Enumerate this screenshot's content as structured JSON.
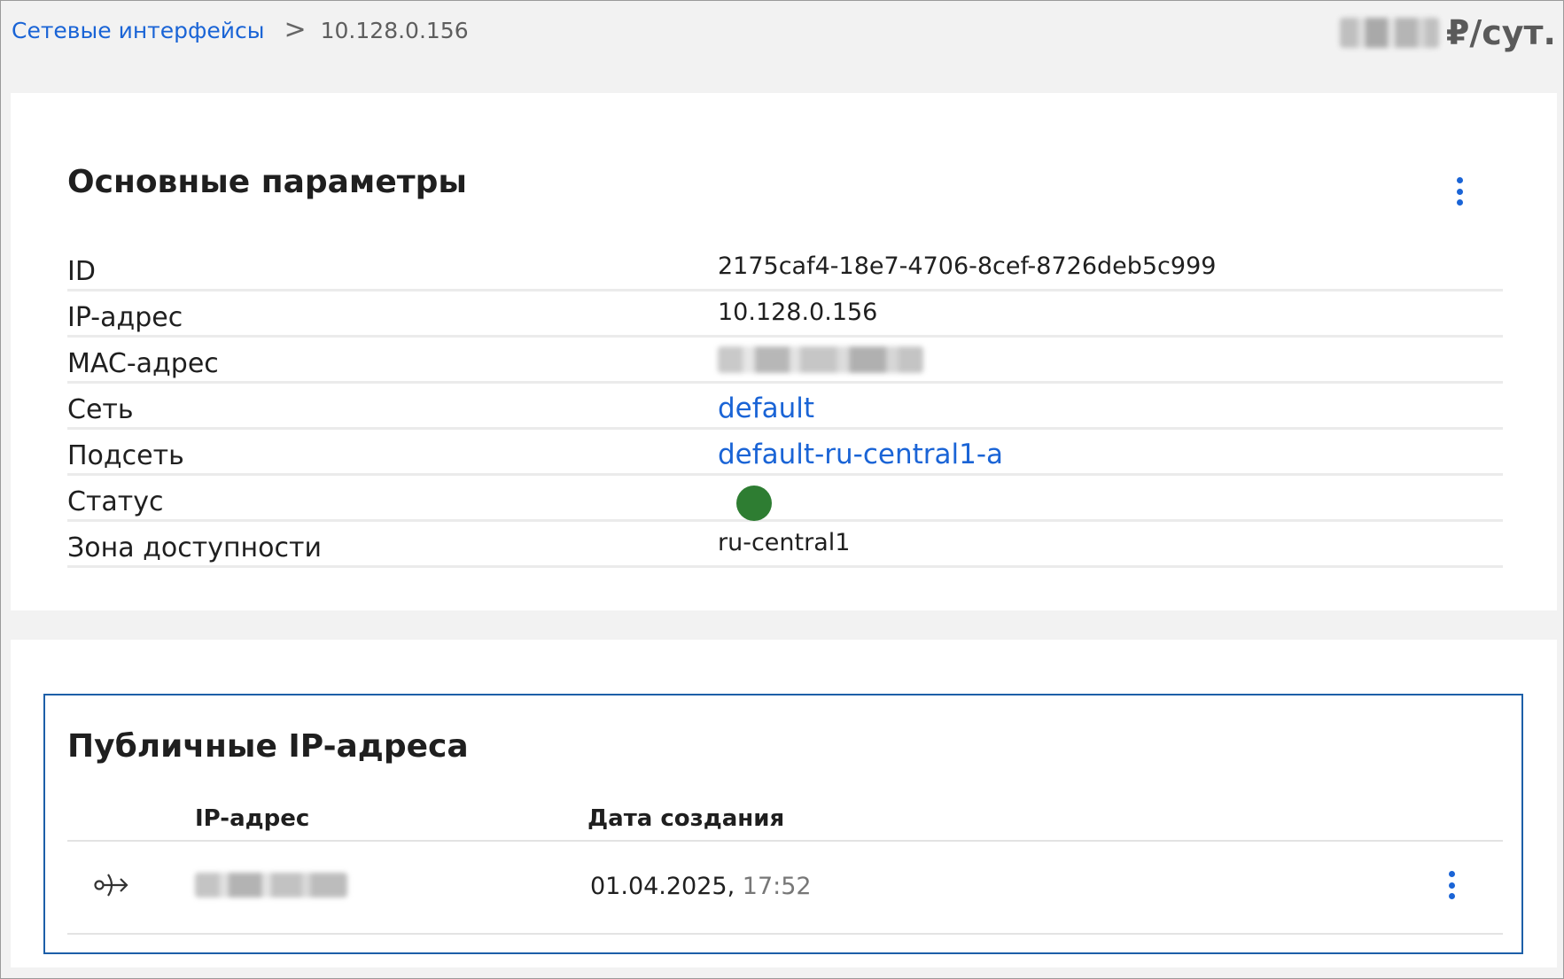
{
  "breadcrumb": {
    "parent": "Сетевые интерфейсы",
    "separator": ">",
    "current": "10.128.0.156"
  },
  "price": {
    "unit": "₽/сут."
  },
  "main_params": {
    "title": "Основные параметры",
    "rows": [
      {
        "label": "ID",
        "value": "2175caf4-18e7-4706-8cef-8726deb5c999"
      },
      {
        "label": "IP-адрес",
        "value": "10.128.0.156"
      },
      {
        "label": "MAC-адрес",
        "value": ""
      },
      {
        "label": "Сеть",
        "value": "default"
      },
      {
        "label": "Подсеть",
        "value": "default-ru-central1-a"
      },
      {
        "label": "Статус",
        "value": ""
      },
      {
        "label": "Зона доступности",
        "value": "ru-central1"
      }
    ],
    "status_color": "#2e7d32"
  },
  "public_ips": {
    "title": "Публичные IP-адреса",
    "columns": [
      "IP-адрес",
      "Дата создания"
    ],
    "rows": [
      {
        "date": "01.04.2025,",
        "time": "17:52",
        "icon": "public-ip-icon"
      }
    ]
  },
  "colors": {
    "accent": "#1a64d6",
    "focus_border": "#1d5fa8"
  }
}
